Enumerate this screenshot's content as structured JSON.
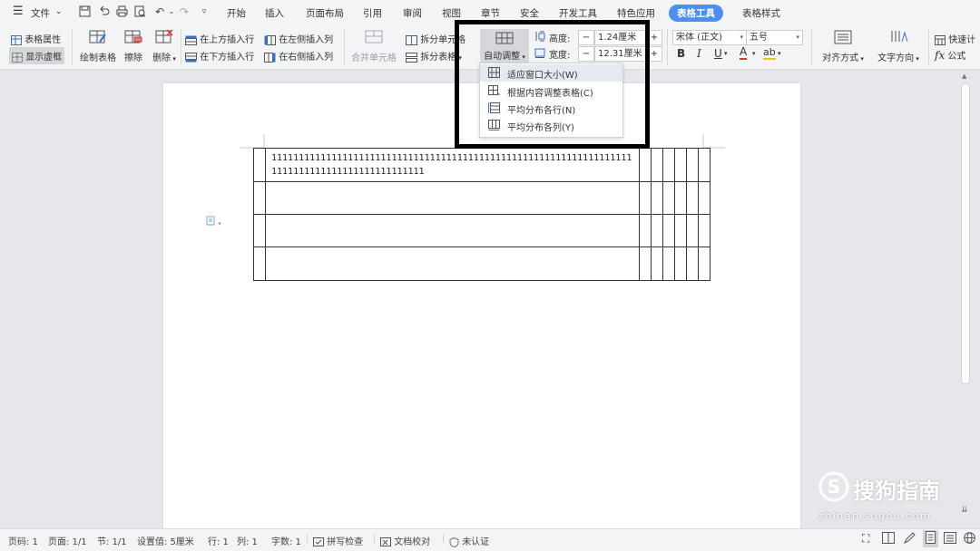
{
  "menubar": {
    "file_label": "文件",
    "tabs": [
      "开始",
      "插入",
      "页面布局",
      "引用",
      "审阅",
      "视图",
      "章节",
      "安全",
      "开发工具",
      "特色应用",
      "表格工具",
      "表格样式"
    ],
    "active_tab": "表格工具"
  },
  "ribbon": {
    "table_properties": "表格属性",
    "show_gridlines": "显示虚框",
    "draw_table": "绘制表格",
    "erase": "擦除",
    "delete": "删除",
    "insert_above": "在上方插入行",
    "insert_below": "在下方插入行",
    "insert_left": "在左侧插入列",
    "insert_right": "在右侧插入列",
    "merge_cells": "合并单元格",
    "split_cells": "拆分单元格",
    "split_table": "拆分表格",
    "auto_fit": "自动调整",
    "height_label": "高度:",
    "height_value": "1.24厘米",
    "width_label": "宽度:",
    "width_value": "12.31厘米",
    "font_name": "宋体 (正文)",
    "font_size": "五号",
    "bold": "B",
    "italic": "I",
    "underline": "U",
    "font_color": "A",
    "highlight": "ab",
    "align": "对齐方式",
    "text_direction": "文字方向",
    "quick_calc": "快速计",
    "formula": "公式",
    "minus": "−",
    "plus": "+"
  },
  "dropdown": {
    "items": [
      "适应窗口大小(W)",
      "根据内容调整表格(C)",
      "平均分布各行(N)",
      "平均分布各列(Y)"
    ]
  },
  "document": {
    "cell_text": "1111111111111111111111111111111111111111111111111111111111111111111111111111111111111111111111"
  },
  "statusbar": {
    "page_code": "页码: 1",
    "page": "页面: 1/1",
    "section": "节: 1/1",
    "setting": "设置值: 5厘米",
    "row": "行: 1",
    "col": "列: 1",
    "word_count": "字数: 1",
    "spell_check": "拼写检查",
    "doc_check": "文档校对",
    "unverified": "未认证"
  },
  "watermark": {
    "brand": "搜狗指南",
    "url": "zhinan.sogou.com"
  }
}
